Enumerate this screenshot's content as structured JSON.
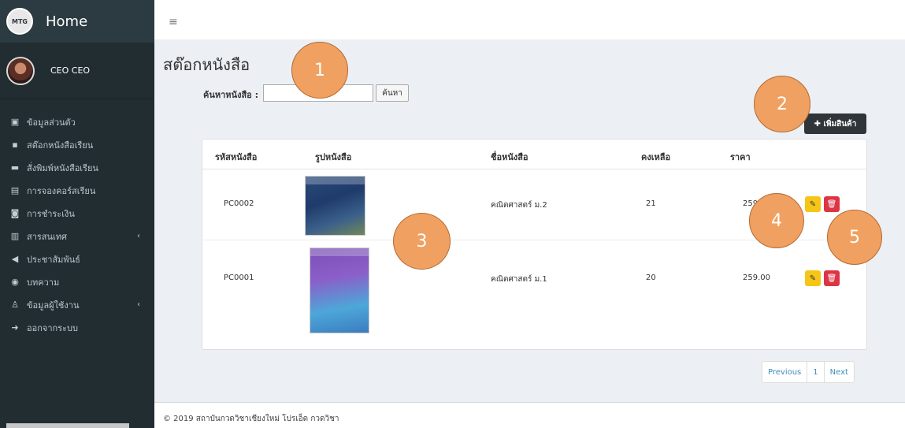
{
  "sidebar": {
    "brand_title": "Home",
    "logo_text": "MTG",
    "user_name": "CEO CEO",
    "items": [
      {
        "icon": "▣",
        "label": "ข้อมูลส่วนตัว",
        "has_caret": false
      },
      {
        "icon": "▪",
        "label": "สต๊อกหนังสือเรียน",
        "has_caret": false
      },
      {
        "icon": "▬",
        "label": "สั่งพิมพ์หนังสือเรียน",
        "has_caret": false
      },
      {
        "icon": "▤",
        "label": "การจองคอร์สเรียน",
        "has_caret": false
      },
      {
        "icon": "◙",
        "label": "การชำระเงิน",
        "has_caret": false
      },
      {
        "icon": "▥",
        "label": "สารสนเทศ",
        "has_caret": true
      },
      {
        "icon": "◀",
        "label": "ประชาสัมพันธ์",
        "has_caret": false
      },
      {
        "icon": "◉",
        "label": "บทความ",
        "has_caret": false
      },
      {
        "icon": "♙",
        "label": "ข้อมูลผู้ใช้งาน",
        "has_caret": true
      },
      {
        "icon": "➜",
        "label": "ออกจากระบบ",
        "has_caret": false
      }
    ],
    "caret": "‹"
  },
  "topbar": {
    "menu_icon": "≡"
  },
  "page": {
    "title": "สต๊อกหนังสือ",
    "search_label": "ค้นหาหนังสือ :",
    "search_value": "",
    "search_button": "ค้นหา",
    "add_button": "✚ เพิ่มสินค้า"
  },
  "table": {
    "headers": [
      "รหัสหนังสือ",
      "รูปหนังสือ",
      "ชื่อหนังสือ",
      "คงเหลือ",
      "ราคา"
    ],
    "rows": [
      {
        "code": "PC0002",
        "name": "คณิตศาสตร์ ม.2",
        "stock": "21",
        "price": "259.00"
      },
      {
        "code": "PC0001",
        "name": "คณิตศาสตร์ ม.1",
        "stock": "20",
        "price": "259.00"
      }
    ],
    "edit_icon": "✎",
    "delete_icon": "🗑"
  },
  "annotations": [
    "1",
    "2",
    "3",
    "4",
    "5"
  ],
  "pagination": {
    "previous": "Previous",
    "page": "1",
    "next": "Next"
  },
  "footer": {
    "text": "© 2019 สถาบันกวดวิชาเชียงใหม่ โปรเอ็ด กวดวิชา"
  },
  "colors": {
    "sidebar_bg": "#222d32",
    "badge_fill": "#f0a060",
    "edit": "#f5c518",
    "delete": "#dc3545",
    "link": "#3c8dbc"
  }
}
